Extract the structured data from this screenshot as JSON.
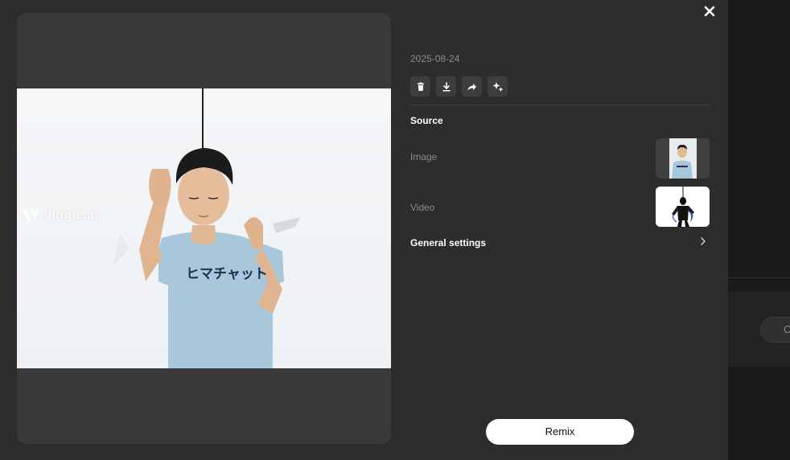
{
  "date": "2025-08-24",
  "actions": [
    "delete-icon",
    "download-icon",
    "share-icon",
    "sparkle-icon"
  ],
  "source": {
    "title": "Source",
    "image_label": "Image",
    "video_label": "Video"
  },
  "general_settings": "General settings",
  "remix_label": "Remix",
  "watermark": "Viggle.ai",
  "shirt_text": "ヒマチャット",
  "background_pill": "C",
  "colors": {
    "modal_bg": "#2d2d2d",
    "preview_bg": "#3a3a3a",
    "shirt": "#a9c7da",
    "button_bg": "#ffffff"
  }
}
